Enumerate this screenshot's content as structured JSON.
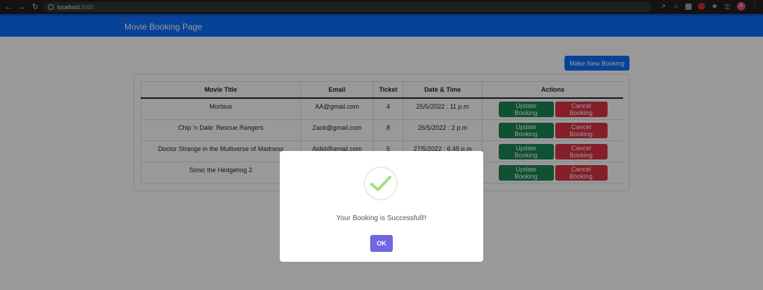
{
  "browser": {
    "url_host": "localhost",
    "url_port": ":3000",
    "avatar_letter": "A"
  },
  "app": {
    "brand": "Movie Booking Page",
    "new_booking_label": "Make New Booking"
  },
  "table": {
    "headers": [
      "Movie Title",
      "Email",
      "Ticket",
      "Date & Time",
      "Actions"
    ],
    "rows": [
      {
        "title": "Morbius",
        "email": "AA@gmail.com",
        "ticket": "4",
        "datetime": "25/5/2022 : 11 p.m"
      },
      {
        "title": "Chip 'n Dale: Rescue Rangers",
        "email": "Zack@gmail.com",
        "ticket": "8",
        "datetime": "26/5/2022 : 2 p.m"
      },
      {
        "title": "Doctor Strange in the Multiverse of Madness",
        "email": "Aidid@gmail.com",
        "ticket": "5",
        "datetime": "27/5/2022 : 6.45 p.m"
      },
      {
        "title": "Sonic the Hedgehog 2",
        "email": "",
        "ticket": "",
        "datetime": ""
      }
    ],
    "update_label": "Update Booking",
    "cancel_label": "Cancel Booking"
  },
  "modal": {
    "icon": "success-check-icon",
    "message": "Your Booking is Successfull!!",
    "ok_label": "OK"
  },
  "colors": {
    "navbar": "#0d6efd",
    "update": "#198754",
    "cancel": "#dc3545",
    "ok": "#7066e0",
    "check": "#a5dc86"
  }
}
